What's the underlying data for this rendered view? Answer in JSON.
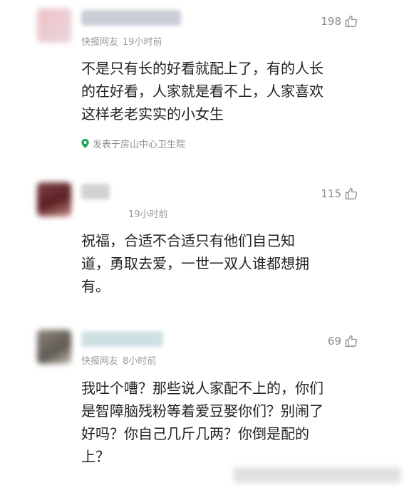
{
  "colors": {
    "text": "#222222",
    "meta": "#9a9a9a",
    "location_icon": "#1fa552"
  },
  "comments": [
    {
      "author": "快报网友",
      "time": "19小时前",
      "likes": "198",
      "lines": [
        "不是只有长的好看就配上了，有的人长",
        "的在好看，人家就是看不上，人家喜欢",
        "这样老老实实的小女生"
      ],
      "location": "发表于房山中心卫生院"
    },
    {
      "author": "",
      "time": "19小时前",
      "likes": "115",
      "lines": [
        "祝福，合适不合适只有他们自己知",
        "道，勇取去爱，一世一双人谁都想拥",
        "有。"
      ]
    },
    {
      "author": "快报网友",
      "time": "8小时前",
      "likes": "69",
      "lines": [
        "我吐个嘈？那些说人家配不上的，你们",
        "是智障脑残粉等着爱豆娶你们？别闹了",
        "好吗？你自己几斤几两？你倒是配的",
        "上？"
      ]
    }
  ],
  "icons": {
    "like": "thumbs-up-icon",
    "location": "location-pin-icon"
  }
}
